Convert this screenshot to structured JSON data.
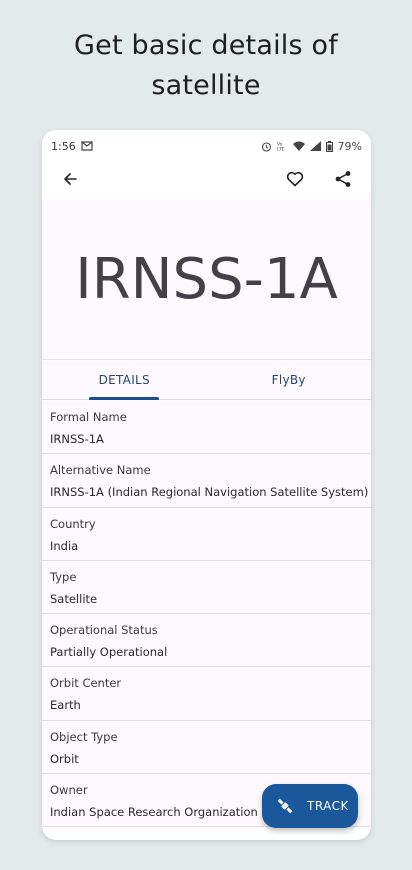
{
  "promo": {
    "line1": "Get basic details of",
    "line2": "satellite"
  },
  "status_bar": {
    "time": "1:56",
    "battery": "79%"
  },
  "app_bar": {
    "back_icon": "back-arrow-icon",
    "favorite_icon": "heart-outline-icon",
    "share_icon": "share-icon"
  },
  "hero": {
    "title": "IRNSS-1A"
  },
  "tabs": [
    {
      "label": "DETAILS",
      "active": true
    },
    {
      "label": "FlyBy",
      "active": false
    }
  ],
  "details": [
    {
      "label": "Formal Name",
      "value": "IRNSS-1A"
    },
    {
      "label": "Alternative Name",
      "value": "IRNSS-1A (Indian Regional Navigation Satellite System)"
    },
    {
      "label": "Country",
      "value": "India"
    },
    {
      "label": "Type",
      "value": "Satellite"
    },
    {
      "label": "Operational Status",
      "value": "Partially Operational"
    },
    {
      "label": "Orbit Center",
      "value": "Earth"
    },
    {
      "label": "Object Type",
      "value": "Orbit"
    },
    {
      "label": "Owner",
      "value": "Indian Space Research Organization (ISRO)"
    }
  ],
  "fab": {
    "label": "TRACK",
    "icon": "satellite-icon"
  },
  "colors": {
    "accent": "#1b579b",
    "background": "#e4e9ea",
    "hero_bg": "#fdf9fd"
  }
}
